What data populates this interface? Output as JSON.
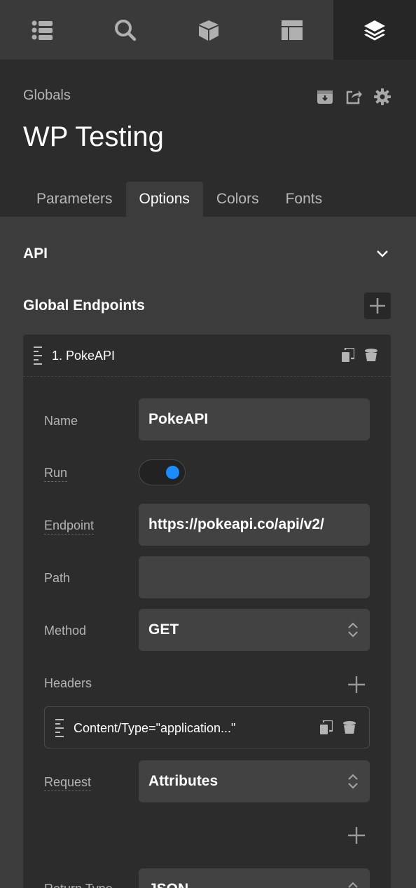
{
  "topbar": {
    "tabs": [
      {
        "icon": "list-icon",
        "active": false
      },
      {
        "icon": "search-icon",
        "active": false
      },
      {
        "icon": "cube-icon",
        "active": false
      },
      {
        "icon": "layout-icon",
        "active": false
      },
      {
        "icon": "layers-icon",
        "active": true
      }
    ]
  },
  "header": {
    "breadcrumb": "Globals",
    "title": "WP Testing",
    "icons": [
      "archive-icon",
      "share-icon",
      "gear-icon"
    ],
    "tabs": [
      {
        "label": "Parameters",
        "active": false
      },
      {
        "label": "Options",
        "active": true
      },
      {
        "label": "Colors",
        "active": false
      },
      {
        "label": "Fonts",
        "active": false
      }
    ]
  },
  "api_section": {
    "title": "API",
    "icon": "chevron-down-icon"
  },
  "endpoints": {
    "title": "Global Endpoints",
    "add_icon": "plus-icon",
    "card": {
      "title": "1. PokeAPI",
      "fields": {
        "name_label": "Name",
        "name_value": "PokeAPI",
        "run_label": "Run",
        "run_on": true,
        "endpoint_label": "Endpoint",
        "endpoint_value": "https://pokeapi.co/api/v2/",
        "path_label": "Path",
        "path_value": "",
        "method_label": "Method",
        "method_value": "GET",
        "headers_label": "Headers",
        "header_item": "Content/Type=\"application...\"",
        "request_label": "Request",
        "request_value": "Attributes",
        "return_label": "Return Type",
        "return_value": "JSON"
      }
    }
  },
  "colors": {
    "accent": "#1a8cff",
    "background": "#3c3c3c",
    "panel": "#2c2c2c",
    "input": "#424242"
  }
}
